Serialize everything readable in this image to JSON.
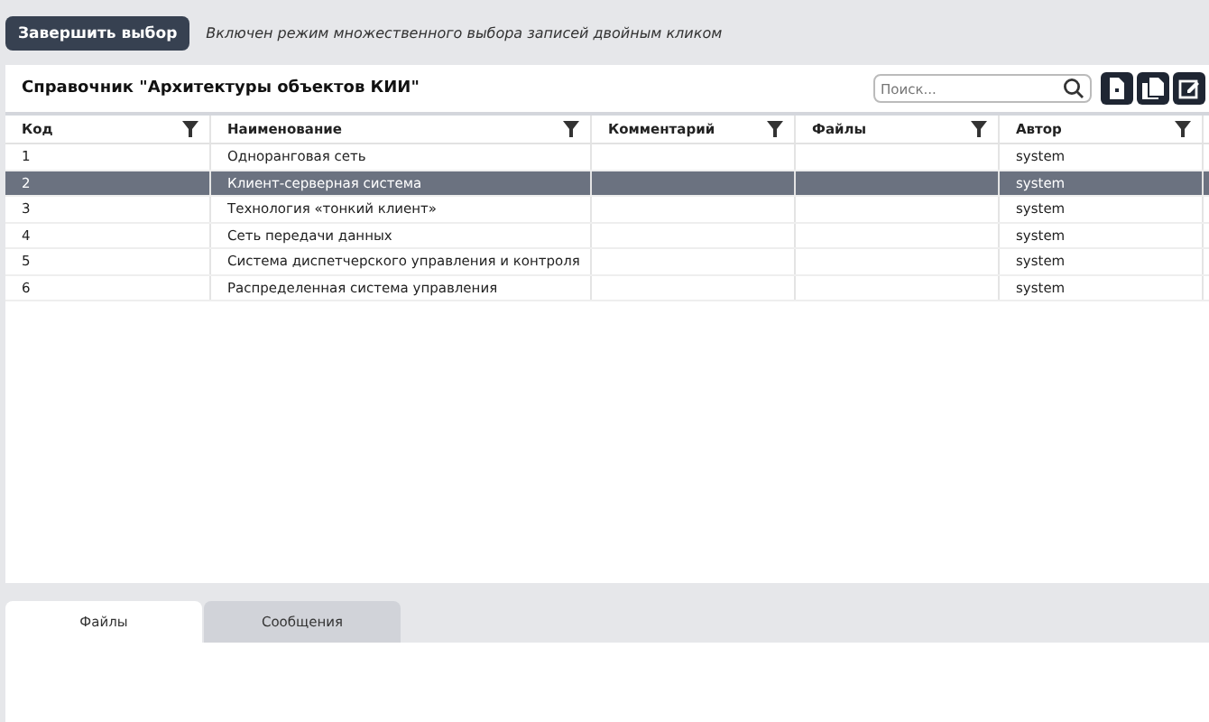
{
  "toolbar": {
    "finish_button": "Завершить выбор",
    "hint": "Включен режим множественного выбора записей двойным кликом"
  },
  "panel": {
    "title": "Справочник \"Архитектуры объектов КИИ\"",
    "search": {
      "placeholder": "Поиск..."
    }
  },
  "table": {
    "columns": [
      "Код",
      "Наименование",
      "Комментарий",
      "Файлы",
      "Автор"
    ],
    "rows": [
      {
        "cells": [
          "1",
          "Одноранговая сеть",
          "",
          "",
          "system"
        ],
        "selected": false
      },
      {
        "cells": [
          "2",
          "Клиент-серверная система",
          "",
          "",
          "system"
        ],
        "selected": true
      },
      {
        "cells": [
          "3",
          "Технология «тонкий клиент»",
          "",
          "",
          "system"
        ],
        "selected": false
      },
      {
        "cells": [
          "4",
          "Сеть передачи данных",
          "",
          "",
          "system"
        ],
        "selected": false
      },
      {
        "cells": [
          "5",
          "Система диспетчерского управления и контроля",
          "",
          "",
          "system"
        ],
        "selected": false
      },
      {
        "cells": [
          "6",
          "Распределенная система управления",
          "",
          "",
          "system"
        ],
        "selected": false
      }
    ]
  },
  "tabs": [
    {
      "label": "Файлы",
      "selected": true
    },
    {
      "label": "Сообщения",
      "selected": false
    }
  ]
}
